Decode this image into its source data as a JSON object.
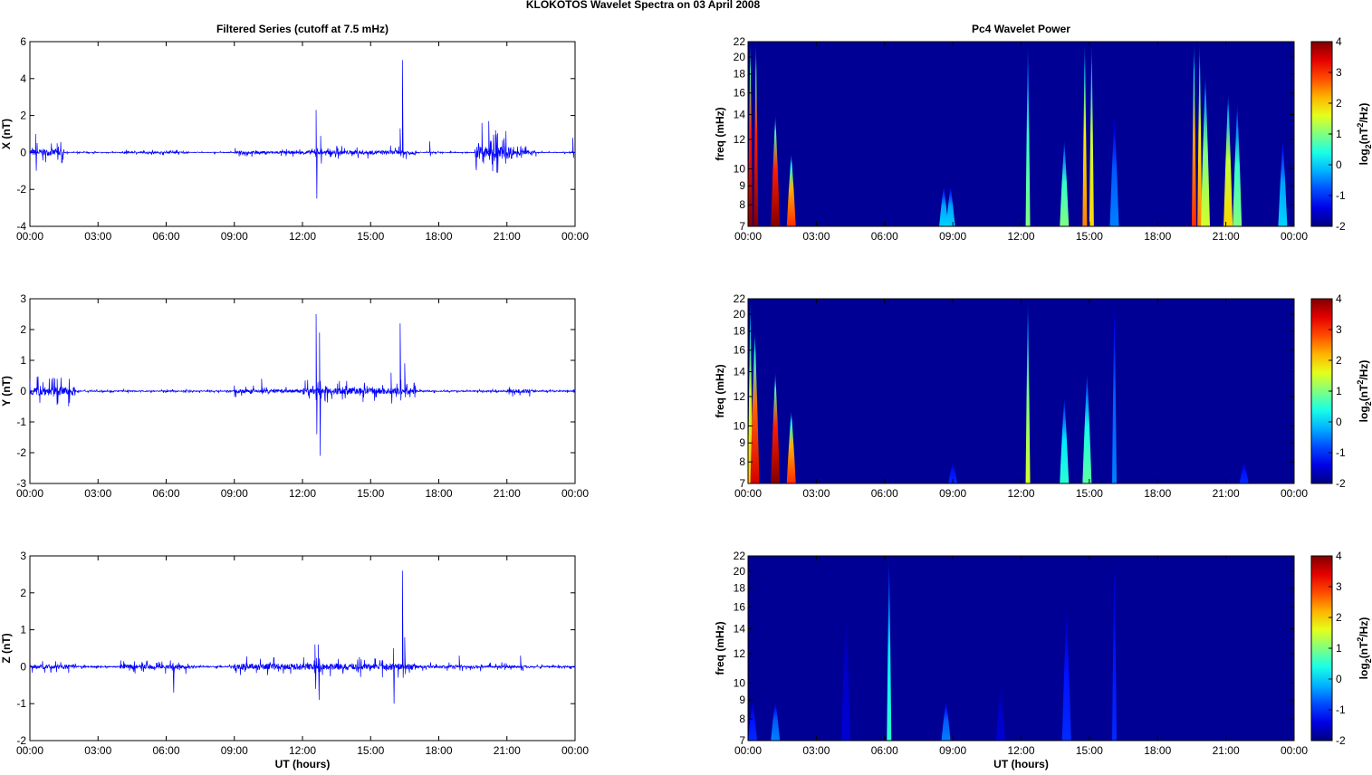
{
  "figure_title": "KLOKOTOS Wavelet Spectra on 03 April     2008",
  "chart_data": [
    {
      "type": "line",
      "title": "Filtered Series (cutoff at 7.5 mHz)",
      "ylabel": "X (nT)",
      "xlabel": "",
      "ylim": [
        -4,
        6
      ],
      "yticks": [
        -4,
        -2,
        0,
        2,
        4,
        6
      ],
      "xlim": [
        0,
        24
      ],
      "xticks": [
        "00:00",
        "03:00",
        "06:00",
        "09:00",
        "12:00",
        "15:00",
        "18:00",
        "21:00",
        "00:00"
      ],
      "series": [
        {
          "name": "X",
          "color": "#0000ff",
          "spikes": [
            [
              0.25,
              1.0,
              -1.0
            ],
            [
              1.2,
              0.5,
              -0.4
            ],
            [
              12.6,
              2.3,
              -2.5
            ],
            [
              12.8,
              0.9,
              -0.6
            ],
            [
              16.4,
              5.0,
              -0.3
            ],
            [
              16.3,
              1.3,
              -0.2
            ],
            [
              17.6,
              0.6,
              -0.2
            ],
            [
              19.9,
              1.6,
              -0.5
            ],
            [
              20.2,
              1.7,
              -0.4
            ],
            [
              20.5,
              1.2,
              -0.3
            ],
            [
              23.9,
              0.8,
              -0.3
            ]
          ],
          "bursts": [
            [
              0,
              1.5,
              0.25
            ],
            [
              4,
              7,
              0.06
            ],
            [
              9,
              12,
              0.1
            ],
            [
              12,
              17,
              0.15
            ],
            [
              19.6,
              21.3,
              0.5
            ],
            [
              21.3,
              22.3,
              0.15
            ]
          ]
        }
      ]
    },
    {
      "type": "line",
      "title": "",
      "ylabel": "Y (nT)",
      "xlabel": "",
      "ylim": [
        -3,
        3
      ],
      "yticks": [
        -3,
        -2,
        -1,
        0,
        1,
        2,
        3
      ],
      "xlim": [
        0,
        24
      ],
      "xticks": [
        "00:00",
        "03:00",
        "06:00",
        "09:00",
        "12:00",
        "15:00",
        "18:00",
        "21:00",
        "00:00"
      ],
      "series": [
        {
          "name": "Y",
          "color": "#0000ff",
          "spikes": [
            [
              1.2,
              0.4,
              -0.4
            ],
            [
              12.6,
              2.5,
              -1.4
            ],
            [
              12.75,
              1.9,
              -2.1
            ],
            [
              16.3,
              2.2,
              -0.3
            ],
            [
              16.5,
              0.9,
              -0.2
            ],
            [
              15.9,
              0.6,
              -0.4
            ],
            [
              10.2,
              0.4,
              -0.1
            ]
          ],
          "bursts": [
            [
              0,
              2,
              0.2
            ],
            [
              9,
              12,
              0.08
            ],
            [
              12,
              17,
              0.15
            ],
            [
              21,
              22,
              0.08
            ]
          ]
        }
      ]
    },
    {
      "type": "line",
      "title": "",
      "ylabel": "Z (nT)",
      "xlabel": "UT (hours)",
      "ylim": [
        -2,
        3
      ],
      "yticks": [
        -2,
        -1,
        0,
        1,
        2,
        3
      ],
      "xlim": [
        0,
        24
      ],
      "xticks": [
        "00:00",
        "03:00",
        "06:00",
        "09:00",
        "12:00",
        "15:00",
        "18:00",
        "21:00",
        "00:00"
      ],
      "series": [
        {
          "name": "Z",
          "color": "#0000ff",
          "spikes": [
            [
              6.3,
              0.1,
              -0.7
            ],
            [
              12.55,
              0.6,
              -0.6
            ],
            [
              12.7,
              0.6,
              -0.9
            ],
            [
              16.4,
              2.6,
              -0.3
            ],
            [
              16.5,
              0.8,
              -0.2
            ],
            [
              16.0,
              0.5,
              -1.0
            ],
            [
              18.9,
              0.3,
              -0.1
            ],
            [
              21.6,
              0.3,
              -0.1
            ]
          ],
          "bursts": [
            [
              0,
              2,
              0.08
            ],
            [
              4,
              7,
              0.08
            ],
            [
              9,
              17,
              0.12
            ],
            [
              17,
              22,
              0.05
            ]
          ]
        }
      ]
    },
    {
      "type": "heatmap",
      "title": "Pc4 Wavelet Power",
      "ylabel": "freq (mHz)",
      "xlabel": "",
      "ylim": [
        7,
        22
      ],
      "yscale": "log",
      "yticks": [
        7,
        8,
        9,
        10,
        12,
        14,
        16,
        18,
        20,
        22
      ],
      "xticks": [
        "00:00",
        "03:00",
        "06:00",
        "09:00",
        "12:00",
        "15:00",
        "18:00",
        "21:00",
        "00:00"
      ],
      "colorbar": {
        "label": "log2(nT2/Hz)",
        "range": [
          -2,
          4
        ],
        "ticks": [
          -2,
          -1,
          0,
          1,
          2,
          3,
          4
        ]
      },
      "events": [
        [
          0.1,
          22,
          4
        ],
        [
          0.35,
          22,
          4
        ],
        [
          1.2,
          14,
          4
        ],
        [
          1.9,
          11,
          3
        ],
        [
          8.6,
          9,
          0
        ],
        [
          8.9,
          9,
          0
        ],
        [
          12.3,
          22,
          1
        ],
        [
          13.9,
          12,
          1
        ],
        [
          14.8,
          22,
          2.5
        ],
        [
          15.1,
          22,
          2
        ],
        [
          16.1,
          14,
          -0.5
        ],
        [
          19.6,
          22,
          3
        ],
        [
          19.85,
          22,
          2.5
        ],
        [
          20.1,
          18,
          1.5
        ],
        [
          21.1,
          16,
          2
        ],
        [
          21.5,
          15,
          1
        ],
        [
          23.5,
          12,
          0
        ]
      ]
    },
    {
      "type": "heatmap",
      "title": "",
      "ylabel": "freq (mHz)",
      "xlabel": "",
      "ylim": [
        7,
        22
      ],
      "yscale": "log",
      "yticks": [
        7,
        8,
        9,
        10,
        12,
        14,
        16,
        18,
        20,
        22
      ],
      "xticks": [
        "00:00",
        "03:00",
        "06:00",
        "09:00",
        "12:00",
        "15:00",
        "18:00",
        "21:00",
        "00:00"
      ],
      "colorbar": {
        "label": "log2(nT2/Hz)",
        "range": [
          -2,
          4
        ],
        "ticks": [
          -2,
          -1,
          0,
          1,
          2,
          3,
          4
        ]
      },
      "events": [
        [
          0.1,
          22,
          2
        ],
        [
          0.3,
          18,
          3.5
        ],
        [
          1.2,
          14,
          4
        ],
        [
          1.9,
          11,
          3
        ],
        [
          9.0,
          8,
          -1
        ],
        [
          12.3,
          22,
          1.5
        ],
        [
          13.9,
          12,
          0.5
        ],
        [
          14.9,
          14,
          0.8
        ],
        [
          16.1,
          22,
          -0.5
        ],
        [
          21.8,
          8,
          -1
        ]
      ]
    },
    {
      "type": "heatmap",
      "title": "",
      "ylabel": "freq (mHz)",
      "xlabel": "UT (hours)",
      "ylim": [
        7,
        22
      ],
      "yscale": "log",
      "yticks": [
        7,
        8,
        9,
        10,
        12,
        14,
        16,
        18,
        20,
        22
      ],
      "xticks": [
        "00:00",
        "03:00",
        "06:00",
        "09:00",
        "12:00",
        "15:00",
        "18:00",
        "21:00",
        "00:00"
      ],
      "colorbar": {
        "label": "log2(nT2/Hz)",
        "range": [
          -2,
          4
        ],
        "ticks": [
          -2,
          -1,
          0,
          1,
          2,
          3,
          4
        ]
      },
      "events": [
        [
          0.2,
          9,
          -1
        ],
        [
          1.2,
          9,
          -0.5
        ],
        [
          4.3,
          16,
          -1.5
        ],
        [
          6.2,
          22,
          0.5
        ],
        [
          8.7,
          9,
          -0.5
        ],
        [
          11.1,
          10,
          -1.5
        ],
        [
          14.0,
          16,
          -1
        ],
        [
          16.1,
          22,
          -1
        ]
      ]
    }
  ]
}
